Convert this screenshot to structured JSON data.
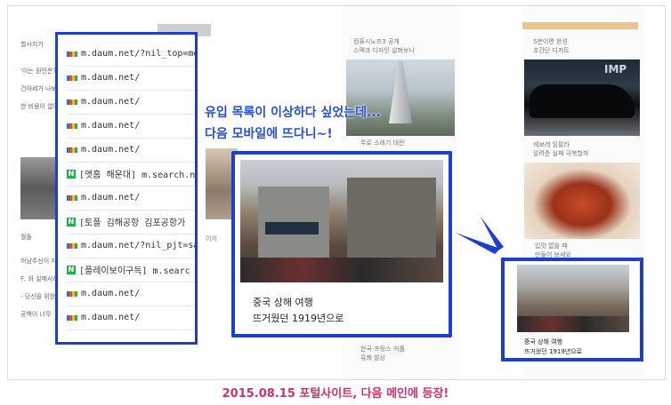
{
  "url_list": [
    {
      "icon": "daum",
      "text": "m.daum.net/?nil_top=mob"
    },
    {
      "icon": "daum",
      "text": "m.daum.net/"
    },
    {
      "icon": "daum",
      "text": "m.daum.net/"
    },
    {
      "icon": "daum",
      "text": "m.daum.net/"
    },
    {
      "icon": "daum",
      "text": "m.daum.net/"
    },
    {
      "icon": "naver",
      "text": "[엣홈 해운대] m.search.na"
    },
    {
      "icon": "daum",
      "text": "m.daum.net/"
    },
    {
      "icon": "naver",
      "text": "[토플 김해공항 김포공항가"
    },
    {
      "icon": "daum",
      "text": "m.daum.net/?nil_pjt=sam"
    },
    {
      "icon": "naver",
      "text": "[플레이보이구독] m.searc"
    },
    {
      "icon": "daum",
      "text": "m.daum.net/"
    },
    {
      "icon": "daum",
      "text": "m.daum.net/"
    }
  ],
  "annotation": {
    "line1": "유입 목록이 이상하다 싶었는데...",
    "line2": "다음 모바일에 뜨다니~!"
  },
  "featured_card": {
    "title_line1": "중국 상해 여행",
    "title_line2": "뜨거웠던 1919년으로"
  },
  "small_card": {
    "title_line1": "중국 상해 여행",
    "title_line2": "뜨거웠던 1919년으로"
  },
  "background_snippets": {
    "top_left_1": "할사지가",
    "left_2": "'이는 원인은?",
    "left_3": "건아세가 나보",
    "left_4": "한 비용이 없어",
    "left_5": "월돌",
    "left_6": "허남주신이 자",
    "left_7": "F, 와 실패사례",
    "left_8": "- 당신을 위한",
    "left_9": "공백이 너무",
    "mid_1": "컴퓨시노프3 공개",
    "mid_2": "스팩과 디자인 살펴보니",
    "mid_3": "뚜로 스레기 대란",
    "mid_4": "한국-프랑스 커플",
    "mid_5": "유쾌 발상",
    "mid_6": "이기",
    "right_1": "5분이면 완성",
    "right_2": "초간단 디저트",
    "right_3": "쉐보레 임팔라",
    "right_4": "알려준 실패 극복할까",
    "right_5": "입맛 없을 때",
    "right_6": "만들어 보세요",
    "car_logo": "IMP"
  },
  "footer_text": "2015.08.15 포털사이트, 다음 메인에 등장!",
  "colors": {
    "highlight_border": "#1e3ed0",
    "annotation_text": "#2a50d0",
    "footer": "#c8336f"
  }
}
